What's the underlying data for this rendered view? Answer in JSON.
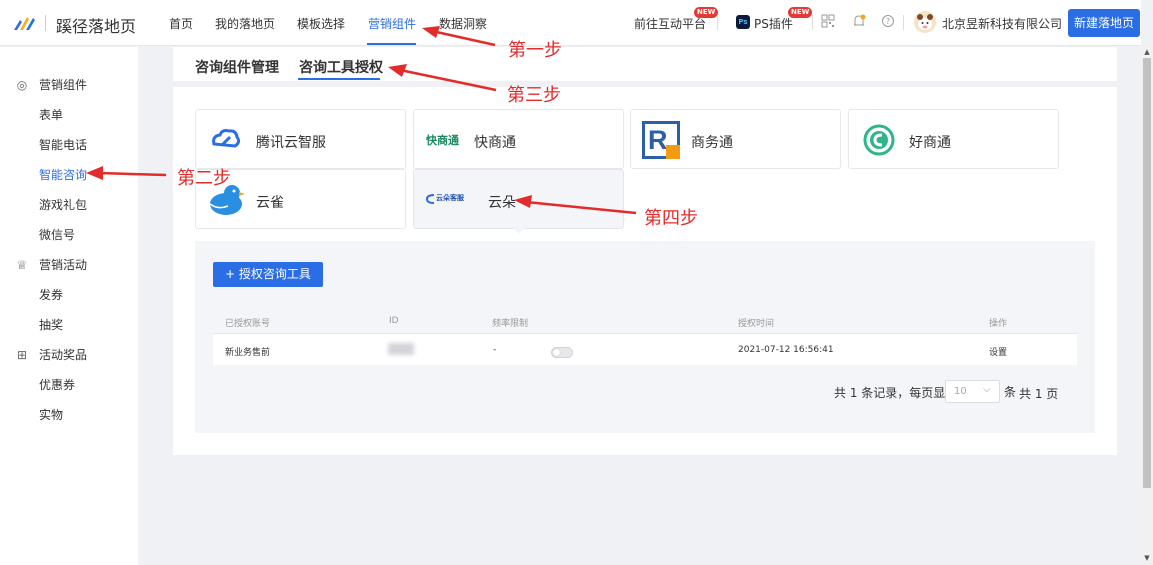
{
  "header": {
    "brand": "蹊径落地页",
    "nav": [
      "首页",
      "我的落地页",
      "模板选择",
      "营销组件",
      "数据洞察"
    ],
    "active_nav": "营销组件",
    "interact_platform": "前往互动平台",
    "ps_plugin": "PS插件",
    "ps_icon_text": "Ps",
    "new_badge": "NEW",
    "company": "北京昱新科技有限公司",
    "create_button": "新建落地页",
    "icons": [
      "qrcode-icon",
      "bell-icon",
      "help-icon"
    ]
  },
  "sidebar": {
    "groups": [
      {
        "label": "营销组件",
        "icon": "target-icon",
        "items": [
          "表单",
          "智能电话",
          "智能咨询",
          "游戏礼包",
          "微信号"
        ]
      },
      {
        "label": "营销活动",
        "icon": "cup-icon",
        "items": [
          "发券",
          "抽奖"
        ]
      },
      {
        "label": "活动奖品",
        "icon": "gift-icon",
        "items": [
          "优惠券",
          "实物"
        ]
      }
    ],
    "active_item": "智能咨询"
  },
  "tabs": [
    "咨询组件管理",
    "咨询工具授权"
  ],
  "active_tab": "咨询工具授权",
  "tools": [
    {
      "name": "腾讯云智服",
      "logo": "tencent-cloud-logo"
    },
    {
      "name": "快商通",
      "logo": "kuaishangtong-logo",
      "logo_text": "快商通"
    },
    {
      "name": "商务通",
      "logo": "shangwutong-logo",
      "logo_text": "R"
    },
    {
      "name": "好商通",
      "logo": "haoshangtong-logo"
    },
    {
      "name": "云雀",
      "logo": "bird-logo"
    },
    {
      "name": "云朵",
      "logo": "yunduo-logo",
      "logo_text": "云朵客服"
    }
  ],
  "selected_tool": "云朵",
  "auth_button": "+ 授权咨询工具",
  "table": {
    "headers": [
      "已授权账号",
      "ID",
      "频率限制",
      "授权时间",
      "操作"
    ],
    "rows": [
      {
        "account": "新业务售前",
        "id": "",
        "limit": "-",
        "time": "2021-07-12 16:56:41",
        "action": "设置",
        "toggle_on": false
      }
    ]
  },
  "pagination": {
    "total_text": "共 1 条记录，每页显示",
    "page_size": "10",
    "unit": "条",
    "pages_text": "共 1 页"
  },
  "annotations": [
    "第一步",
    "第二步",
    "第三步",
    "第四步"
  ],
  "colors": {
    "primary": "#2b6de5",
    "annotation": "#e32b2b",
    "badge": "#e53935"
  }
}
